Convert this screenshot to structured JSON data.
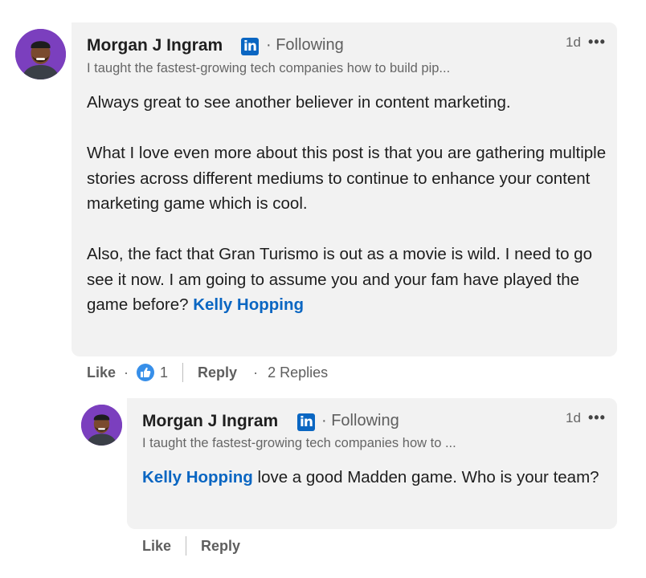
{
  "comment": {
    "author": "Morgan J Ingram",
    "badge": "in",
    "following": "· Following",
    "headline": "I taught the fastest-growing tech companies how to build pip...",
    "time": "1d",
    "more": "•••",
    "paragraph1": "Always great to see another believer in content marketing.",
    "paragraph2": "What I love even more about this post is that you are gathering multiple stories across different mediums to continue to enhance your content marketing game which is cool.",
    "paragraph3_text": "Also, the fact that Gran Turismo is out as a movie is wild. I need to go see it now. I am going to assume you and your fam have played the game before? ",
    "paragraph3_mention": "Kelly Hopping",
    "actions": {
      "like": "Like",
      "dot": "·",
      "reaction_count": "1",
      "reply": "Reply",
      "replies": "2 Replies"
    }
  },
  "reply": {
    "author": "Morgan J Ingram",
    "badge": "in",
    "following": "· Following",
    "headline": "I taught the fastest-growing tech companies how to ...",
    "time": "1d",
    "more": "•••",
    "mention": "Kelly Hopping",
    "text": " love a good Madden game. Who is your team?",
    "actions": {
      "like": "Like",
      "reply": "Reply"
    }
  },
  "colors": {
    "accent": "#0a66c2",
    "bubble": "#f2f2f2",
    "avatar_bg": "#7b3fbe",
    "like_icon": "#378fe9"
  },
  "icons": [
    "avatar",
    "linkedin-badge-icon",
    "more-options-icon",
    "like-reaction-icon"
  ]
}
